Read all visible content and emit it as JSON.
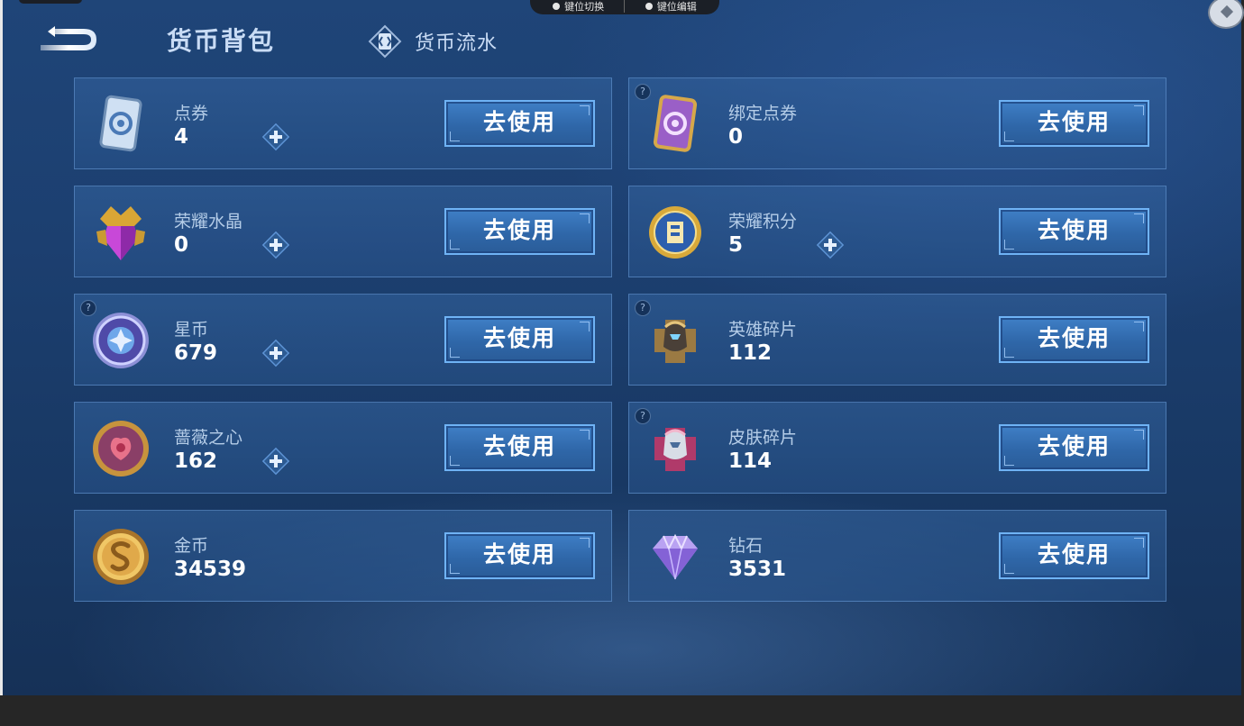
{
  "header": {
    "title": "货币背包",
    "flow_tab_label": "货币流水"
  },
  "overlay": {
    "left_label": "键位切换",
    "right_label": "键位编辑"
  },
  "use_label": "去使用",
  "hint_mark": "?",
  "currencies": [
    {
      "name": "点券",
      "value": "4",
      "icon": "coupon-ticket-icon",
      "has_plus": true,
      "has_hint": false
    },
    {
      "name": "绑定点券",
      "value": "0",
      "icon": "bound-coupon-icon",
      "has_plus": false,
      "has_hint": true
    },
    {
      "name": "荣耀水晶",
      "value": "0",
      "icon": "glory-crystal-icon",
      "has_plus": true,
      "has_hint": false
    },
    {
      "name": "荣耀积分",
      "value": "5",
      "icon": "glory-points-icon",
      "has_plus": true,
      "has_hint": false
    },
    {
      "name": "星币",
      "value": "679",
      "icon": "star-coin-icon",
      "has_plus": true,
      "has_hint": true
    },
    {
      "name": "英雄碎片",
      "value": "112",
      "icon": "hero-fragment-icon",
      "has_plus": false,
      "has_hint": true
    },
    {
      "name": "蔷薇之心",
      "value": "162",
      "icon": "rose-heart-icon",
      "has_plus": true,
      "has_hint": false
    },
    {
      "name": "皮肤碎片",
      "value": "114",
      "icon": "skin-fragment-icon",
      "has_plus": false,
      "has_hint": true
    },
    {
      "name": "金币",
      "value": "34539",
      "icon": "gold-coin-icon",
      "has_plus": false,
      "has_hint": false
    },
    {
      "name": "钻石",
      "value": "3531",
      "icon": "diamond-icon",
      "has_plus": false,
      "has_hint": false
    }
  ],
  "colors": {
    "background": "#1c3f70",
    "button": "#2f67a9",
    "button_border": "#6fb3f5",
    "label": "#b5cde8"
  }
}
